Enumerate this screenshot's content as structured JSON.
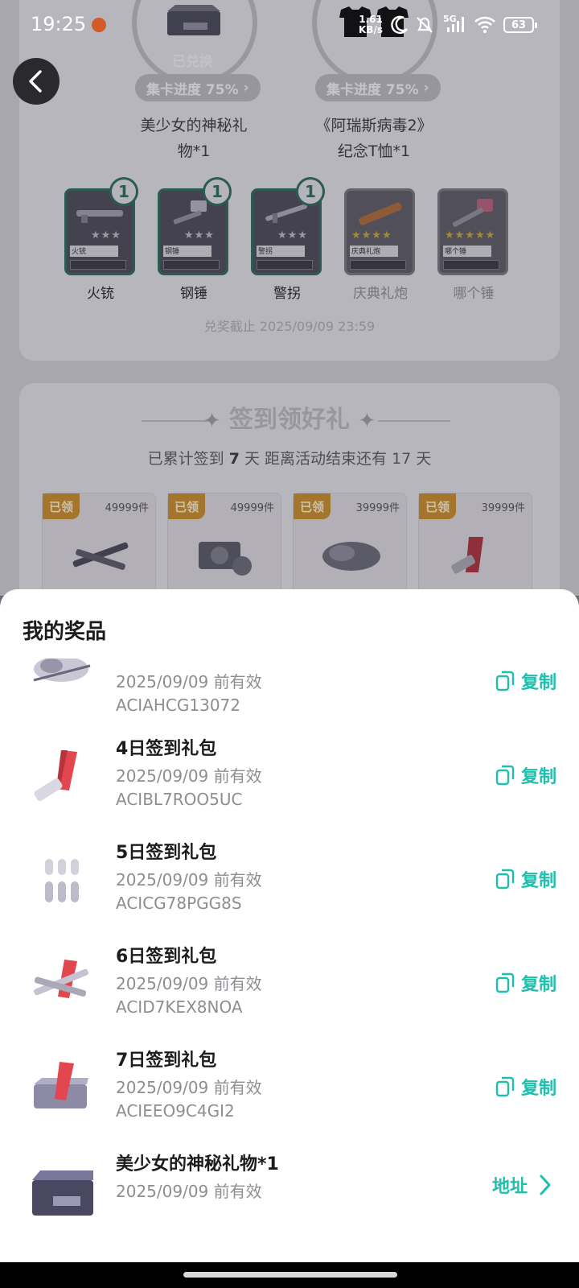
{
  "status_bar": {
    "time": "19:25",
    "speed_value": "1.61",
    "speed_unit": "KB/s",
    "network": "5G",
    "battery": "63"
  },
  "background": {
    "rewards": [
      {
        "status": "已兑换",
        "progress": "集卡进度 75%",
        "name_line1": "美少女的神秘礼",
        "name_line2": "物*1"
      },
      {
        "status": "",
        "progress": "集卡进度 75%",
        "name_line1": "《阿瑞斯病毒2》",
        "name_line2": "纪念T恤*1"
      }
    ],
    "items": [
      {
        "label": "火铳",
        "badge": "1",
        "tag": "火铳",
        "owned": true
      },
      {
        "label": "钢锤",
        "badge": "1",
        "tag": "钢锤",
        "owned": true
      },
      {
        "label": "警拐",
        "badge": "1",
        "tag": "警拐",
        "owned": true
      },
      {
        "label": "庆典礼炮",
        "badge": "",
        "tag": "庆典礼炮",
        "owned": false
      },
      {
        "label": "哪个锤",
        "badge": "",
        "tag": "哪个锤",
        "owned": false
      }
    ],
    "deadline": "兑奖截止 2025/09/09 23:59",
    "signin_title": "签到领好礼",
    "signin_sub_prefix": "已累计签到",
    "signin_days": "7",
    "signin_sub_mid": "天  距离活动结束还有",
    "signin_remaining": "17",
    "signin_sub_suffix": "天",
    "day_cards": [
      {
        "status": "已领",
        "count": "49999件"
      },
      {
        "status": "已领",
        "count": "49999件"
      },
      {
        "status": "已领",
        "count": "39999件"
      },
      {
        "status": "已领",
        "count": "39999件"
      }
    ]
  },
  "sheet": {
    "title": "我的奖品",
    "prizes": [
      {
        "name": "",
        "valid": "2025/09/09 前有效",
        "code": "ACIAHCG13072",
        "action": "复制",
        "icon": "sleeping-bag-icon"
      },
      {
        "name": "4日签到礼包",
        "valid": "2025/09/09 前有效",
        "code": "ACIBL7ROO5UC",
        "action": "复制",
        "icon": "flare-gun-icon"
      },
      {
        "name": "5日签到礼包",
        "valid": "2025/09/09 前有效",
        "code": "ACICG78PGG8S",
        "action": "复制",
        "icon": "bullets-icon"
      },
      {
        "name": "6日签到礼包",
        "valid": "2025/09/09 前有效",
        "code": "ACID7KEX8NOA",
        "action": "复制",
        "icon": "weapons-bundle-icon"
      },
      {
        "name": "7日签到礼包",
        "valid": "2025/09/09 前有效",
        "code": "ACIEEO9C4GI2",
        "action": "复制",
        "icon": "supply-crate-icon"
      },
      {
        "name": "美少女的神秘礼物*1",
        "valid": "2025/09/09 前有效",
        "code": "",
        "action": "地址",
        "icon": "mystery-box-icon"
      }
    ]
  },
  "colors": {
    "accent": "#1fbfae",
    "owned_border": "#2f6b5e",
    "claimed_badge": "#c38a2e"
  }
}
